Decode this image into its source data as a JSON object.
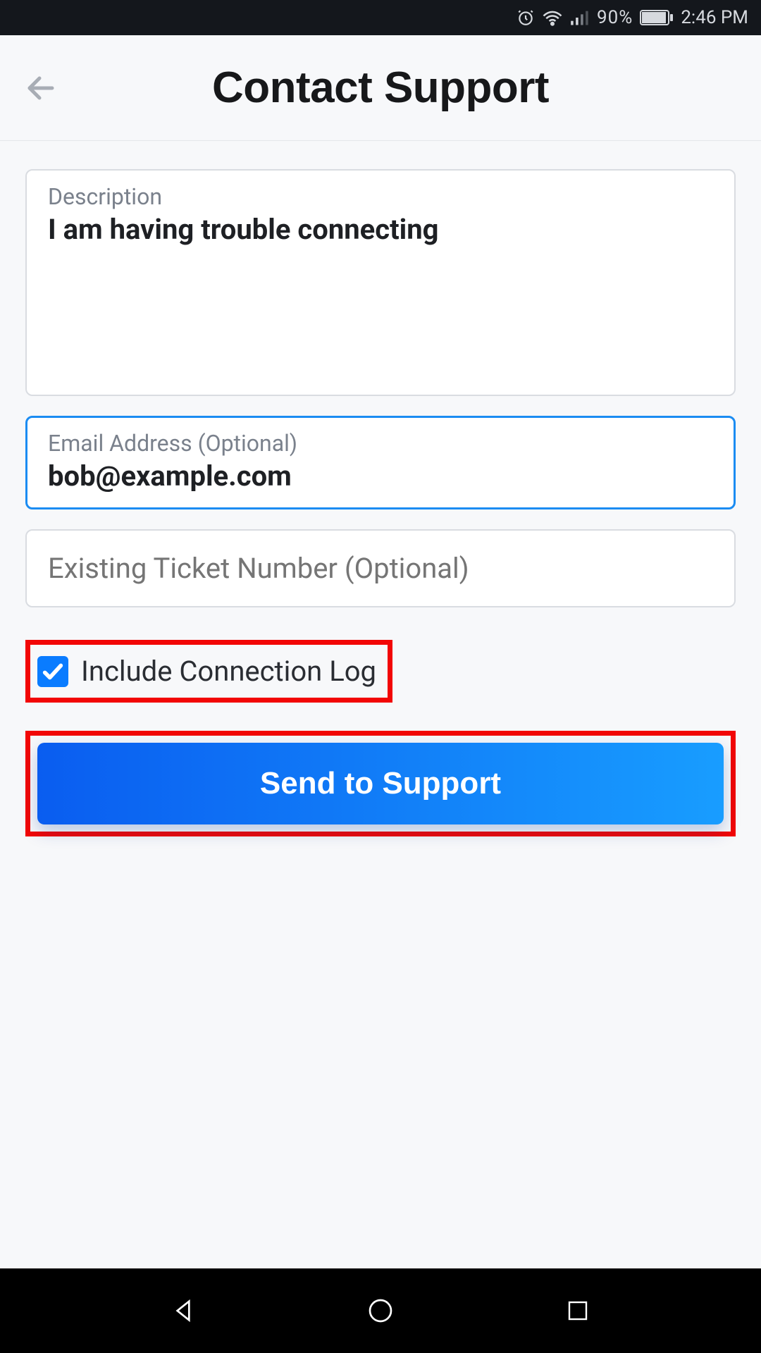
{
  "status_bar": {
    "battery_percent": "90%",
    "time": "2:46 PM",
    "icons": {
      "alarm": "alarm-icon",
      "wifi": "wifi-icon",
      "signal": "signal-icon",
      "battery": "battery-icon"
    }
  },
  "header": {
    "title": "Contact Support"
  },
  "form": {
    "description": {
      "label": "Description",
      "value": "I am having trouble connecting"
    },
    "email": {
      "label": "Email Address (Optional)",
      "value": "bob@example.com"
    },
    "ticket": {
      "placeholder": "Existing Ticket Number (Optional)",
      "value": ""
    },
    "include_log": {
      "label": "Include Connection Log",
      "checked": true
    },
    "submit_label": "Send to Support"
  },
  "colors": {
    "accent": "#0a7cff",
    "highlight": "#f20606",
    "button_gradient_start": "#0a5df0",
    "button_gradient_end": "#189dff"
  }
}
